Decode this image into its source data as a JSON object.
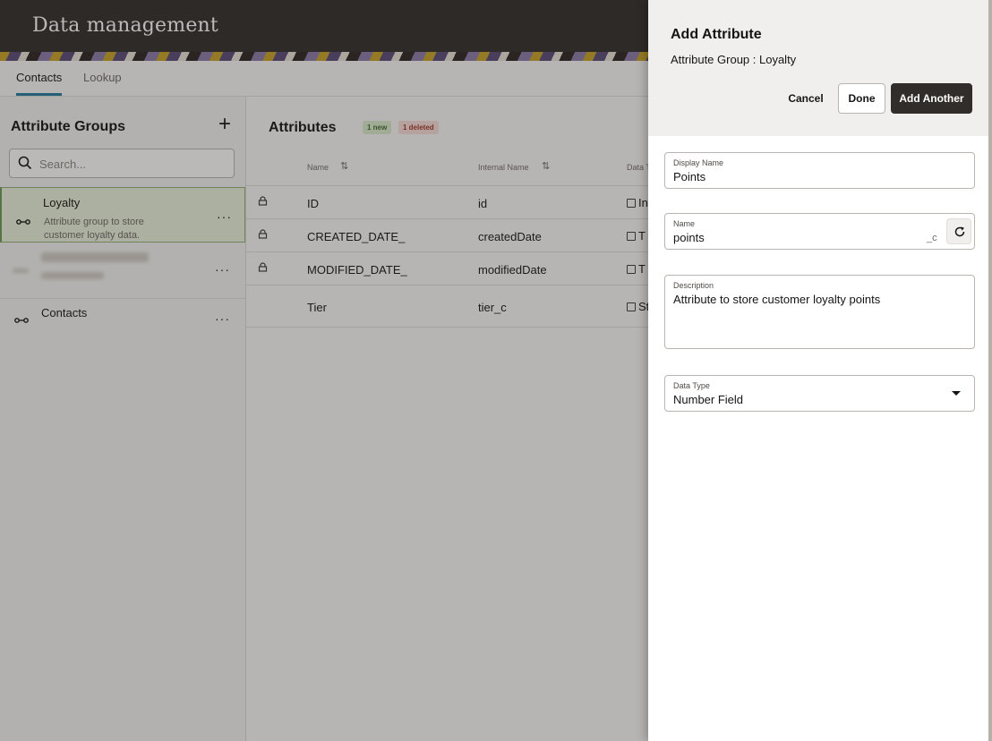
{
  "app": {
    "title": "Data management",
    "tabs": [
      {
        "label": "Contacts",
        "active": true
      },
      {
        "label": "Lookup",
        "active": false
      }
    ]
  },
  "attribute_groups": {
    "title": "Attribute Groups",
    "add_icon": "plus-icon",
    "search_placeholder": "Search...",
    "items": [
      {
        "name": "Loyalty",
        "description": "Attribute group to store customer loyalty data.",
        "selected": true
      },
      {
        "name": "",
        "description": "",
        "selected": false
      },
      {
        "name": "Contacts",
        "description": "",
        "selected": false
      }
    ]
  },
  "attributes": {
    "title": "Attributes",
    "badges": {
      "new": "1 new",
      "deleted": "1 deleted"
    },
    "columns": [
      "Name",
      "Internal Name",
      "Data T"
    ],
    "rows": [
      {
        "name": "ID",
        "internal": "id",
        "type": "In",
        "locked": true
      },
      {
        "name": "CREATED_DATE_",
        "internal": "createdDate",
        "type": "T",
        "locked": true
      },
      {
        "name": "MODIFIED_DATE_",
        "internal": "modifiedDate",
        "type": "T",
        "locked": true
      },
      {
        "name": "Tier",
        "internal": "tier_c",
        "type": "St",
        "locked": false
      }
    ]
  },
  "drawer": {
    "title": "Add Attribute",
    "subtitle": "Attribute Group : Loyalty",
    "buttons": {
      "cancel": "Cancel",
      "done": "Done",
      "add_another": "Add Another"
    },
    "display_name": {
      "label": "Display Name",
      "value": "Points"
    },
    "name": {
      "label": "Name",
      "value": "points",
      "suffix": "_c"
    },
    "description": {
      "label": "Description",
      "value": "Attribute to store customer loyalty points"
    },
    "data_type": {
      "label": "Data Type",
      "value": "Number Field"
    }
  }
}
